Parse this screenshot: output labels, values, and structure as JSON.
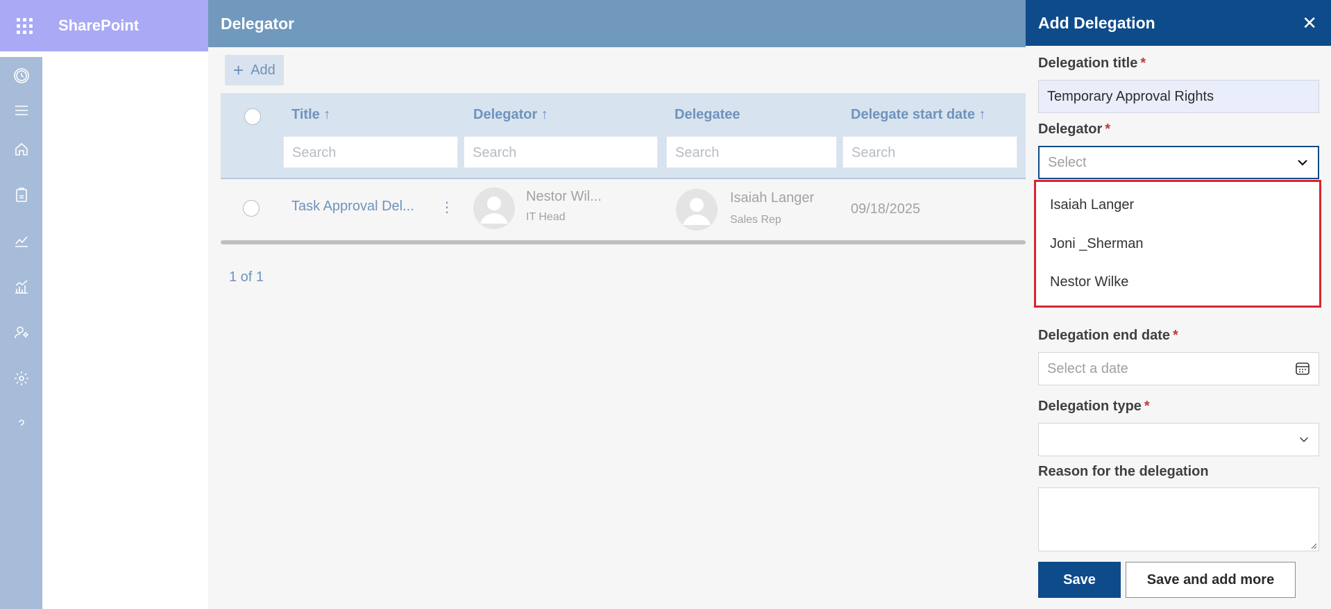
{
  "suite": {
    "brand": "SharePoint"
  },
  "rail": {
    "icons": [
      "clock-icon",
      "menu-icon",
      "home-icon",
      "clipboard-icon",
      "line-chart-icon",
      "bar-chart-icon",
      "user-settings-icon",
      "settings-icon",
      "help-icon"
    ]
  },
  "main": {
    "title": "Delegator",
    "add_label": "Add",
    "columns": [
      {
        "label": "Title ↑",
        "search": "Search"
      },
      {
        "label": "Delegator ↑",
        "search": "Search"
      },
      {
        "label": "Delegatee",
        "search": "Search"
      },
      {
        "label": "Delegate start date ↑",
        "search": "Search"
      }
    ],
    "rows": [
      {
        "title": "Task Approval Del...",
        "delegator": {
          "name": "Nestor Wil...",
          "role": "IT Head"
        },
        "delegatee": {
          "name": "Isaiah Langer",
          "role": "Sales Rep"
        },
        "start_date": "09/18/2025"
      }
    ],
    "pager": "1 of 1"
  },
  "panel": {
    "title": "Add Delegation",
    "fields": {
      "title": {
        "label": "Delegation title",
        "value": "Temporary Approval Rights"
      },
      "delegator": {
        "label": "Delegator",
        "placeholder": "Select",
        "options": [
          "Isaiah Langer",
          "Joni _Sherman",
          "Nestor Wilke"
        ]
      },
      "end_date": {
        "label": "Delegation end date",
        "placeholder": "Select a date"
      },
      "type": {
        "label": "Delegation type",
        "value": ""
      },
      "reason": {
        "label": "Reason for the delegation",
        "value": ""
      }
    },
    "save_label": "Save",
    "save_more_label": "Save and add more",
    "required_mark": "*"
  },
  "colors": {
    "header": "#7198bd",
    "panel_header": "#0e4b8a",
    "accent": "#6f93bc",
    "highlight": "#d9232e"
  }
}
